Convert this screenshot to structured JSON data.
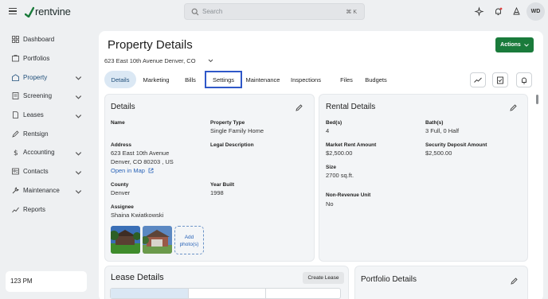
{
  "app": {
    "logo_text": "rentvine",
    "brand_color": "#1a7b3b",
    "search_placeholder": "Search",
    "search_shortcut": "⌘ K",
    "avatar_initials": "WD"
  },
  "sidebar": {
    "items": [
      {
        "label": "Dashboard",
        "icon": "dashboard-icon",
        "has_chevron": false
      },
      {
        "label": "Portfolios",
        "icon": "portfolios-icon",
        "has_chevron": false
      },
      {
        "label": "Property",
        "icon": "property-icon",
        "has_chevron": true
      },
      {
        "label": "Screening",
        "icon": "screening-icon",
        "has_chevron": true
      },
      {
        "label": "Leases",
        "icon": "leases-icon",
        "has_chevron": true
      },
      {
        "label": "Rentsign",
        "icon": "rentsign-icon",
        "has_chevron": false
      },
      {
        "label": "Accounting",
        "icon": "dollar-icon",
        "has_chevron": true
      },
      {
        "label": "Contacts",
        "icon": "contacts-icon",
        "has_chevron": true
      },
      {
        "label": "Maintenance",
        "icon": "wrench-icon",
        "has_chevron": true
      },
      {
        "label": "Reports",
        "icon": "reports-icon",
        "has_chevron": false
      }
    ],
    "active": "Property",
    "clock": "123 PM"
  },
  "page": {
    "title": "Property Details",
    "address": "623 East 10th Avenue Denver, CO",
    "actions_label": "Actions"
  },
  "tabs": [
    "Details",
    "Marketing",
    "Bills",
    "Settings",
    "Maintenance",
    "Inspections",
    "Files",
    "Budgets"
  ],
  "details": {
    "title": "Details",
    "name_label": "Name",
    "property_type_label": "Property Type",
    "property_type": "Single Family Home",
    "address_label": "Address",
    "address_line1": "623 East 10th Avenue",
    "address_line2": "Denver, CO 80203 , US",
    "open_in_map": "Open in Map",
    "legal_description_label": "Legal Description",
    "county_label": "County",
    "county": "Denver",
    "year_built_label": "Year Built",
    "year_built": "1998",
    "assignee_label": "Assignee",
    "assignee": "Shaina Kwiatkowski",
    "add_photo_line1": "Add",
    "add_photo_line2": "photo(s)"
  },
  "rental": {
    "title": "Rental Details",
    "beds_label": "Bed(s)",
    "beds": "4",
    "baths_label": "Bath(s)",
    "baths": "3 Full, 0 Half",
    "market_rent_label": "Market Rent Amount",
    "market_rent": "$2,500.00",
    "deposit_label": "Security Deposit Amount",
    "deposit": "$2,500.00",
    "size_label": "Size",
    "size": "2700 sq.ft.",
    "non_revenue_label": "Non-Revenue Unit",
    "non_revenue": "No"
  },
  "lease": {
    "title": "Lease Details",
    "create_label": "Create Lease"
  },
  "portfolio": {
    "title": "Portfolio Details"
  }
}
